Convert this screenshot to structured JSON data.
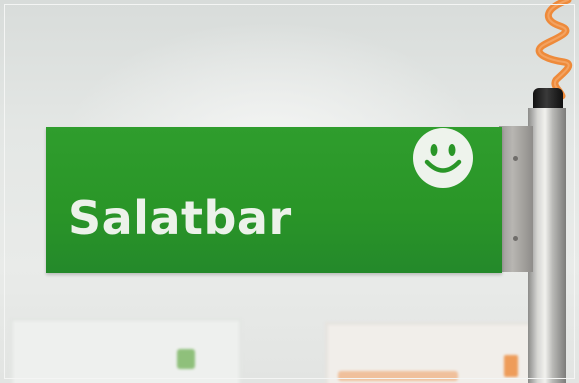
{
  "scene": {
    "description_free_note": "",
    "sign": {
      "text": "Salatbar",
      "color": "#2a9628",
      "text_color": "#ecf2ea",
      "icon": "smiley-face-icon"
    },
    "pole": {
      "cable_color": "#ee8a3a"
    },
    "background_posters": [
      {
        "accent_color": "#8fc07b"
      },
      {
        "accent_color": "#ee9c5a"
      }
    ]
  }
}
